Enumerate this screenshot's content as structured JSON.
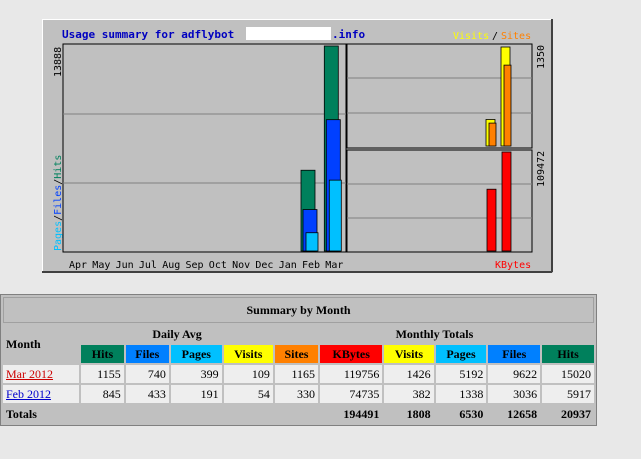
{
  "graph": {
    "title": "Usage summary for adflybot",
    "title_suffix": ".info",
    "legend_right_visits": "Visits",
    "legend_right_sep": "/",
    "legend_right_sites": "Sites",
    "legend_left_pages": "Pages",
    "legend_left_files": "Files",
    "legend_left_hits": "Hits",
    "legend_sep": "/",
    "kbytes_label": "KBytes",
    "max_hits_label": "13888",
    "max_visits_label": "1350",
    "max_kbytes_label": "109472",
    "months": [
      "Apr",
      "May",
      "Jun",
      "Jul",
      "Aug",
      "Sep",
      "Oct",
      "Nov",
      "Dec",
      "Jan",
      "Feb",
      "Mar"
    ],
    "colors": {
      "hits": "#00805c",
      "files": "#0040ff",
      "pages": "#00c0ff",
      "visits": "#ffff00",
      "sites": "#ff8000",
      "kbytes": "#ff0000"
    }
  },
  "chart_data": {
    "type": "bar",
    "categories": [
      "Apr",
      "May",
      "Jun",
      "Jul",
      "Aug",
      "Sep",
      "Oct",
      "Nov",
      "Dec",
      "Jan",
      "Feb",
      "Mar"
    ],
    "series": [
      {
        "name": "Hits",
        "values": [
          0,
          0,
          0,
          0,
          0,
          0,
          0,
          0,
          0,
          0,
          5917,
          15020
        ]
      },
      {
        "name": "Files",
        "values": [
          0,
          0,
          0,
          0,
          0,
          0,
          0,
          0,
          0,
          0,
          3036,
          9622
        ]
      },
      {
        "name": "Pages",
        "values": [
          0,
          0,
          0,
          0,
          0,
          0,
          0,
          0,
          0,
          0,
          1338,
          5192
        ]
      },
      {
        "name": "Visits",
        "values": [
          0,
          0,
          0,
          0,
          0,
          0,
          0,
          0,
          0,
          0,
          382,
          1426
        ]
      },
      {
        "name": "Sites",
        "values": [
          0,
          0,
          0,
          0,
          0,
          0,
          0,
          0,
          0,
          0,
          330,
          1165
        ]
      },
      {
        "name": "KBytes",
        "values": [
          0,
          0,
          0,
          0,
          0,
          0,
          0,
          0,
          0,
          0,
          74735,
          119756
        ]
      }
    ]
  },
  "table": {
    "title": "Summary by Month",
    "month_header": "Month",
    "daily_avg_header": "Daily Avg",
    "monthly_totals_header": "Monthly Totals",
    "daily_cols": [
      {
        "label": "Hits",
        "bg": "#00805c",
        "fg": "#000000"
      },
      {
        "label": "Files",
        "bg": "#0080ff",
        "fg": "#000000"
      },
      {
        "label": "Pages",
        "bg": "#00c0ff",
        "fg": "#000000"
      },
      {
        "label": "Visits",
        "bg": "#ffff00",
        "fg": "#000000"
      }
    ],
    "monthly_cols": [
      {
        "label": "Sites",
        "bg": "#ff8000",
        "fg": "#000000"
      },
      {
        "label": "KBytes",
        "bg": "#ff0000",
        "fg": "#000000"
      },
      {
        "label": "Visits",
        "bg": "#ffff00",
        "fg": "#000000"
      },
      {
        "label": "Pages",
        "bg": "#00c0ff",
        "fg": "#000000"
      },
      {
        "label": "Files",
        "bg": "#0080ff",
        "fg": "#000000"
      },
      {
        "label": "Hits",
        "bg": "#00805c",
        "fg": "#000000"
      }
    ],
    "rows": [
      {
        "month": "Mar 2012",
        "current": true,
        "values": [
          "1155",
          "740",
          "399",
          "109",
          "1165",
          "119756",
          "1426",
          "5192",
          "9622",
          "15020"
        ]
      },
      {
        "month": "Feb 2012",
        "current": false,
        "values": [
          "845",
          "433",
          "191",
          "54",
          "330",
          "74735",
          "382",
          "1338",
          "3036",
          "5917"
        ]
      }
    ],
    "totals_label": "Totals",
    "totals": [
      "194491",
      "1808",
      "6530",
      "12658",
      "20937"
    ]
  }
}
